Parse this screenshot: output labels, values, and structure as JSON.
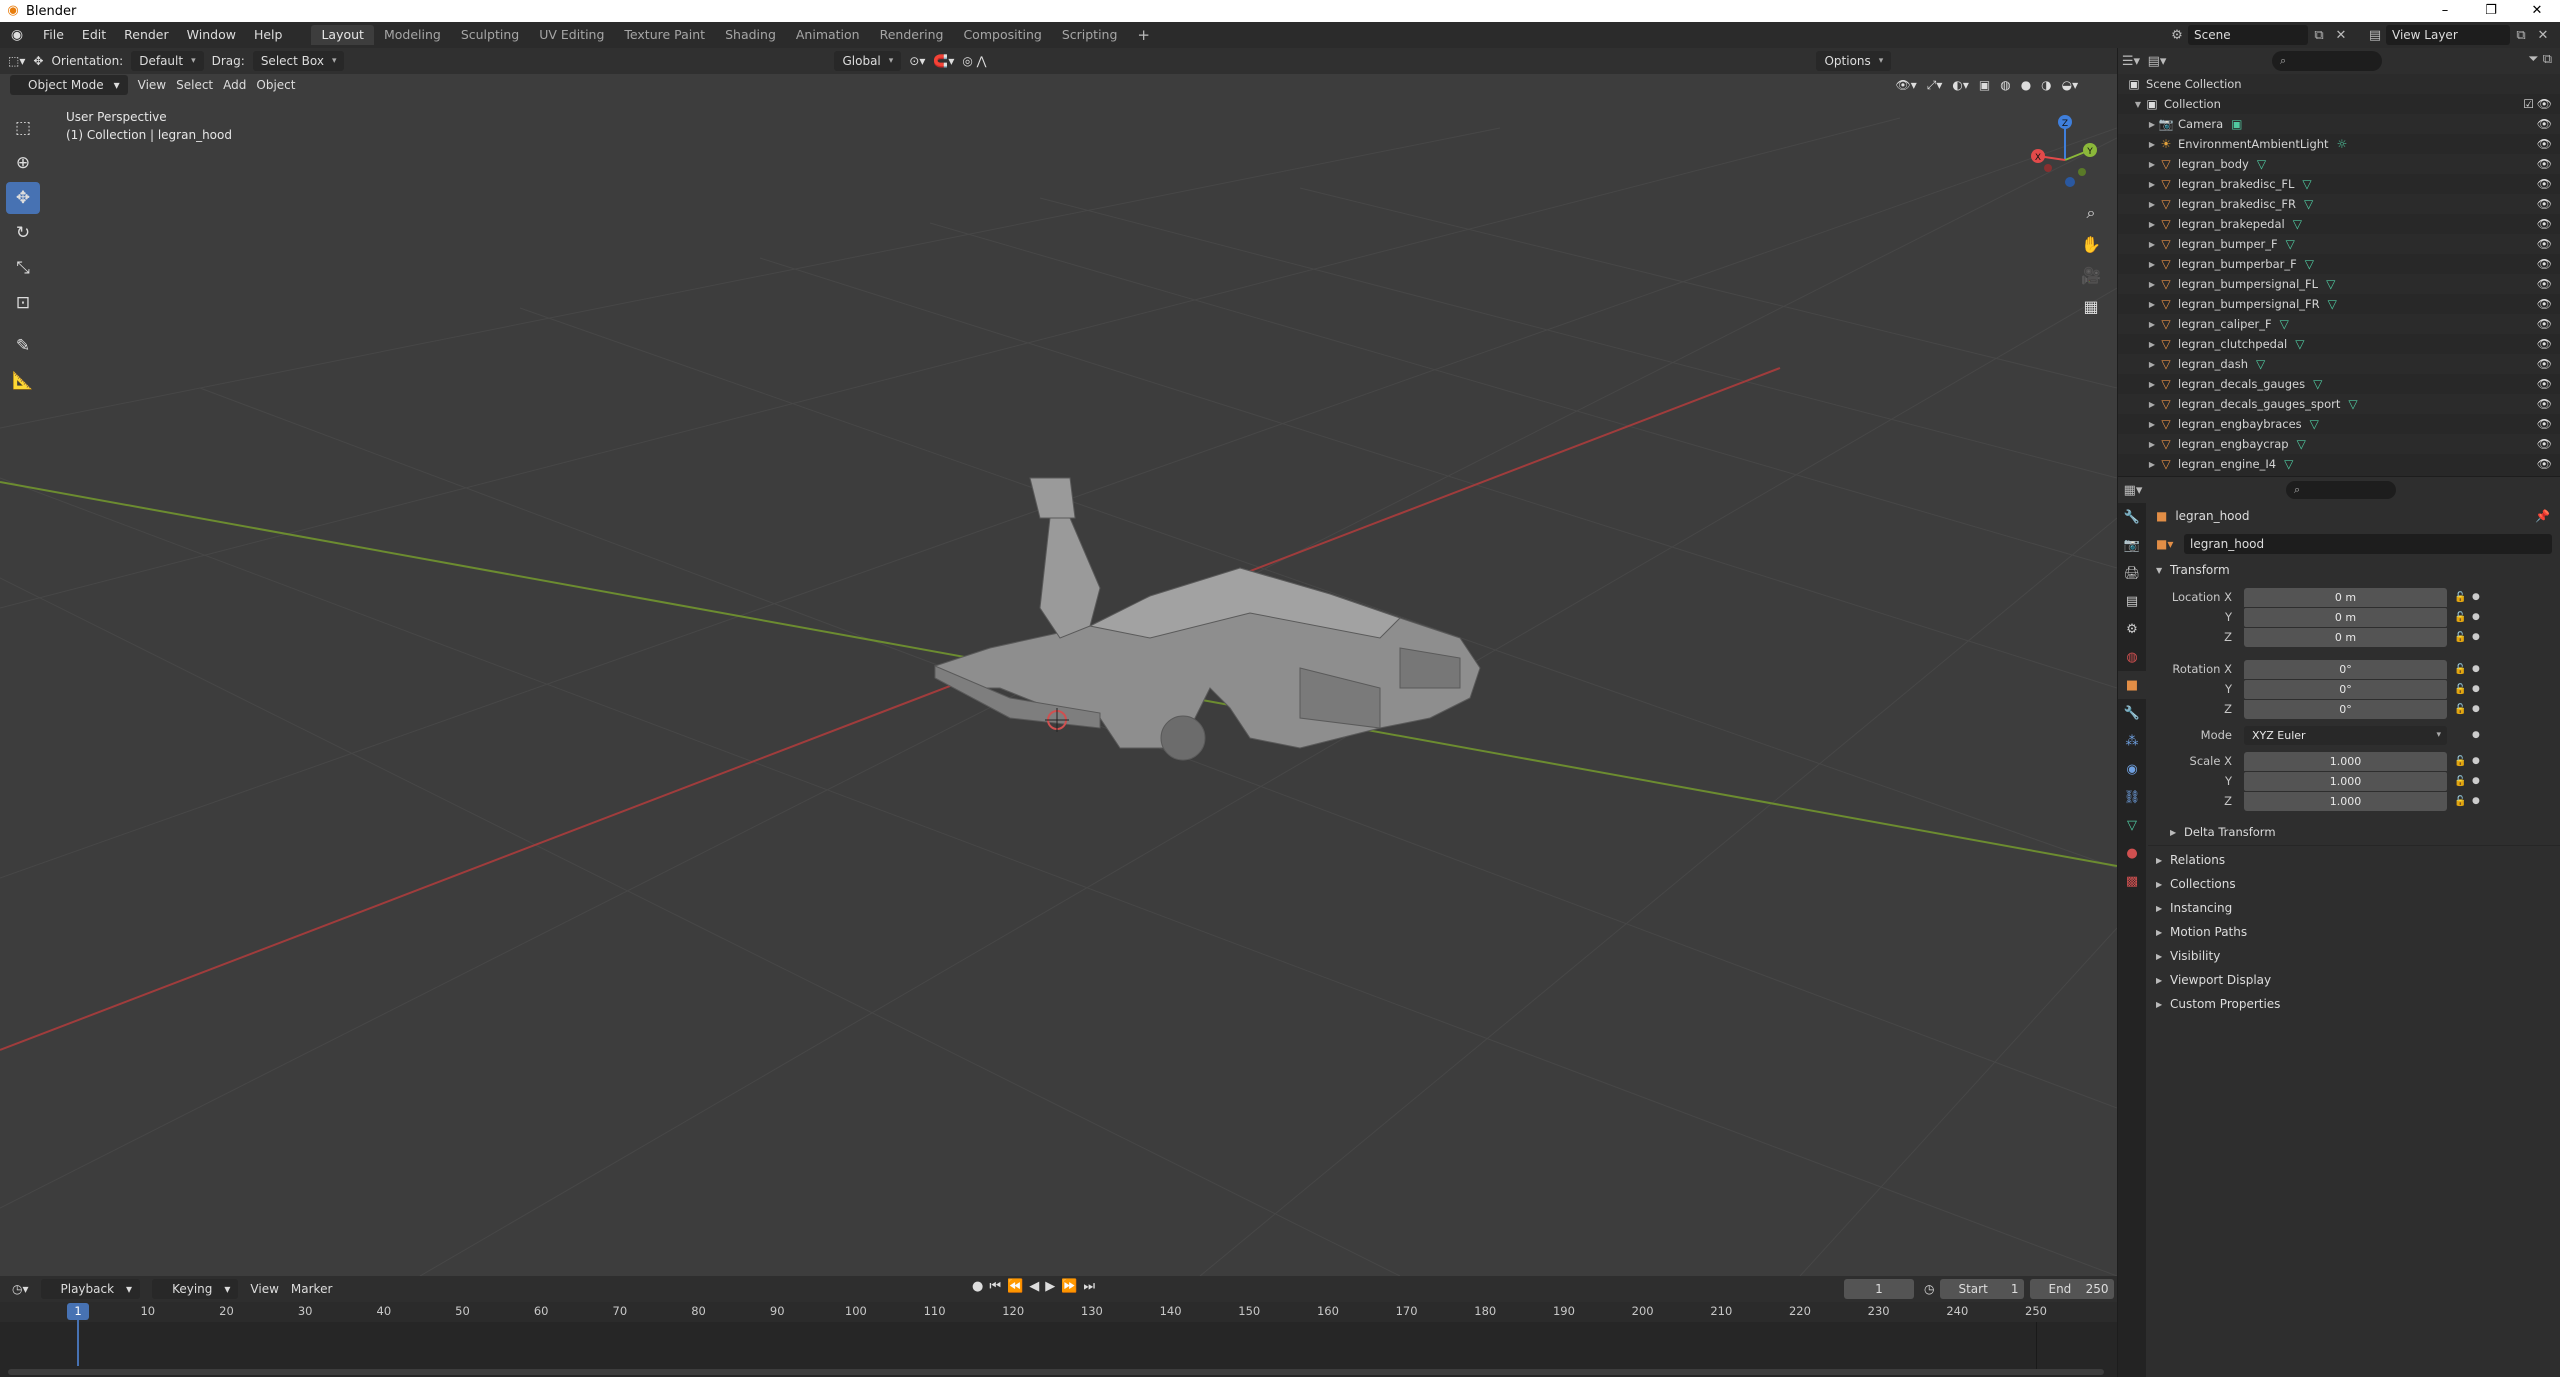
{
  "window": {
    "title": "Blender",
    "min": "–",
    "max": "❐",
    "close": "✕"
  },
  "menu": [
    "File",
    "Edit",
    "Render",
    "Window",
    "Help"
  ],
  "workspaces": [
    {
      "label": "Layout",
      "active": true
    },
    {
      "label": "Modeling"
    },
    {
      "label": "Sculpting"
    },
    {
      "label": "UV Editing"
    },
    {
      "label": "Texture Paint"
    },
    {
      "label": "Shading"
    },
    {
      "label": "Animation"
    },
    {
      "label": "Rendering"
    },
    {
      "label": "Compositing"
    },
    {
      "label": "Scripting"
    }
  ],
  "scene": {
    "name": "Scene",
    "view_layer": "View Layer"
  },
  "viewport": {
    "orientation_label": "Orientation:",
    "orientation_value": "Default",
    "drag_label": "Drag:",
    "drag_value": "Select Box",
    "transform_orientation": "Global",
    "options": "Options",
    "mode": "Object Mode",
    "menus": [
      "View",
      "Select",
      "Add",
      "Object"
    ],
    "info_line1": "User Perspective",
    "info_line2": "(1) Collection | legran_hood",
    "gizmo": {
      "z": "Z",
      "y": "Y",
      "x": "X"
    }
  },
  "timeline": {
    "menus": [
      "Playback",
      "Keying",
      "View",
      "Marker"
    ],
    "current_frame": "1",
    "start_label": "Start",
    "start_value": "1",
    "end_label": "End",
    "end_value": "250",
    "ticks": [
      "10",
      "20",
      "30",
      "40",
      "50",
      "60",
      "70",
      "80",
      "90",
      "100",
      "110",
      "120",
      "130",
      "140",
      "150",
      "160",
      "170",
      "180",
      "190",
      "200",
      "210",
      "220",
      "230",
      "240",
      "250"
    ],
    "cursor_label": "1"
  },
  "outliner": {
    "root": "Scene Collection",
    "collection": "Collection",
    "items": [
      {
        "name": "Camera",
        "type": "camera"
      },
      {
        "name": "EnvironmentAmbientLight",
        "type": "light"
      },
      {
        "name": "legran_body",
        "type": "mesh"
      },
      {
        "name": "legran_brakedisc_FL",
        "type": "mesh"
      },
      {
        "name": "legran_brakedisc_FR",
        "type": "mesh"
      },
      {
        "name": "legran_brakepedal",
        "type": "mesh"
      },
      {
        "name": "legran_bumper_F",
        "type": "mesh"
      },
      {
        "name": "legran_bumperbar_F",
        "type": "mesh"
      },
      {
        "name": "legran_bumpersignal_FL",
        "type": "mesh"
      },
      {
        "name": "legran_bumpersignal_FR",
        "type": "mesh"
      },
      {
        "name": "legran_caliper_F",
        "type": "mesh"
      },
      {
        "name": "legran_clutchpedal",
        "type": "mesh"
      },
      {
        "name": "legran_dash",
        "type": "mesh"
      },
      {
        "name": "legran_decals_gauges",
        "type": "mesh"
      },
      {
        "name": "legran_decals_gauges_sport",
        "type": "mesh"
      },
      {
        "name": "legran_engbaybraces",
        "type": "mesh"
      },
      {
        "name": "legran_engbaycrap",
        "type": "mesh"
      },
      {
        "name": "legran_engine_I4",
        "type": "mesh"
      }
    ]
  },
  "properties": {
    "object_name": "legran_hood",
    "datablock": "legran_hood",
    "transform_title": "Transform",
    "location": {
      "label_x": "Location X",
      "label_y": "Y",
      "label_z": "Z",
      "x": "0 m",
      "y": "0 m",
      "z": "0 m"
    },
    "rotation": {
      "label_x": "Rotation X",
      "label_y": "Y",
      "label_z": "Z",
      "x": "0°",
      "y": "0°",
      "z": "0°"
    },
    "mode": {
      "label": "Mode",
      "value": "XYZ Euler"
    },
    "scale": {
      "label_x": "Scale X",
      "label_y": "Y",
      "label_z": "Z",
      "x": "1.000",
      "y": "1.000",
      "z": "1.000"
    },
    "delta_transform": "Delta Transform",
    "panels": [
      "Relations",
      "Collections",
      "Instancing",
      "Motion Paths",
      "Visibility",
      "Viewport Display",
      "Custom Properties"
    ]
  },
  "colors": {
    "accent": "#4772b3",
    "x_axis": "#e24a4a",
    "y_axis": "#8bb83a",
    "z_axis": "#3f7fdc",
    "object_orange": "#e28e46",
    "mesh_green": "#50c9a0"
  }
}
